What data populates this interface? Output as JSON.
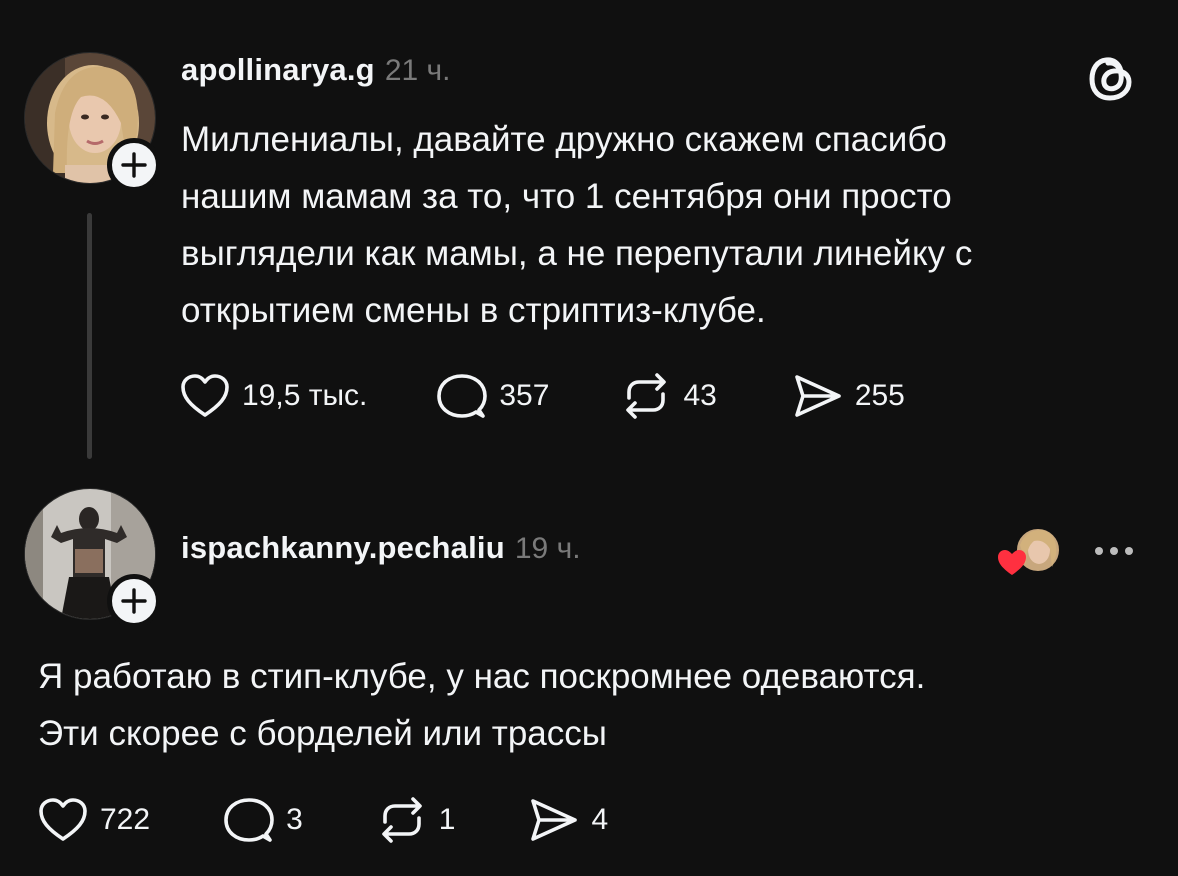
{
  "post": {
    "username": "apollinarya.g",
    "timestamp": "21 ч.",
    "text": "Миллениалы, давайте дружно скажем спасибо\nнашим мамам за то, что 1 сентября они просто\nвыглядели как мамы, а не перепутали линейку с\nоткрытием смены в стриптиз-клубе.",
    "likes": "19,5 тыс.",
    "replies": "357",
    "reposts": "43",
    "shares": "255"
  },
  "reply": {
    "username": "ispachkanny.pechaliu",
    "timestamp": "19 ч.",
    "text": "Я работаю в стип-клубе, у нас поскромнее одеваются.\nЭти скорее с борделей или трассы",
    "likes": "722",
    "replies": "3",
    "reposts": "1",
    "shares": "4"
  },
  "icons": {
    "app_logo": "threads-logo-icon",
    "like": "heart-icon",
    "reply": "speech-bubble-icon",
    "repost": "repost-arrows-icon",
    "share": "send-icon",
    "follow": "plus-icon",
    "more": "more-dots-icon",
    "author_liked": "red-heart-icon"
  },
  "colors": {
    "background": "#101010",
    "text": "#f3f5f7",
    "muted": "#7a7a7a",
    "like_red": "#ff3040"
  }
}
